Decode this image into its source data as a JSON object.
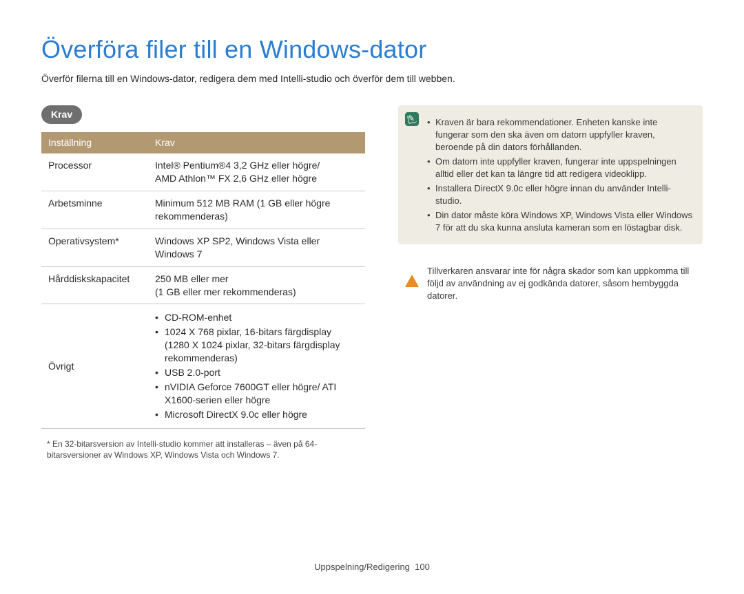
{
  "title": "Överföra filer till en Windows-dator",
  "subtitle": "Överför filerna till en Windows-dator, redigera dem med Intelli-studio och överför dem till webben.",
  "section": {
    "heading": "Krav",
    "table": {
      "head_setting": "Inställning",
      "head_req": "Krav",
      "rows_simple": [
        {
          "label": "Processor",
          "value": "Intel® Pentium®4 3,2 GHz eller högre/\nAMD Athlon™ FX 2,6 GHz eller högre"
        },
        {
          "label": "Arbetsminne",
          "value": "Minimum 512 MB RAM (1 GB eller högre rekommenderas)"
        },
        {
          "label": "Operativsystem*",
          "value": "Windows XP SP2, Windows Vista eller Windows 7"
        },
        {
          "label": "Hårddiskskapacitet",
          "value": "250 MB eller mer\n(1 GB eller mer rekommenderas)"
        }
      ],
      "row_other": {
        "label": "Övrigt",
        "items": [
          "CD-ROM-enhet",
          "1024 X 768 pixlar, 16-bitars färgdisplay (1280 X 1024 pixlar, 32-bitars färgdisplay rekommenderas)",
          "USB 2.0-port",
          "nVIDIA Geforce 7600GT eller högre/ ATI X1600-serien eller högre",
          "Microsoft DirectX 9.0c eller högre"
        ]
      }
    },
    "footnote": "* En 32-bitarsversion av Intelli-studio kommer att installeras – även på 64-bitarsversioner av Windows XP, Windows Vista och Windows 7."
  },
  "info_box": {
    "items": [
      "Kraven är bara rekommendationer. Enheten kanske inte fungerar som den ska även om datorn uppfyller kraven, beroende på din dators förhållanden.",
      "Om datorn inte uppfyller kraven, fungerar inte uppspelningen alltid eller det kan ta längre tid att redigera videoklipp.",
      "Installera DirectX 9.0c eller högre innan du använder Intelli-studio.",
      "Din dator måste köra Windows XP, Windows Vista eller Windows 7 för att du ska kunna ansluta kameran som en löstagbar disk."
    ]
  },
  "warn_box": {
    "text": "Tillverkaren ansvarar inte för några skador som kan uppkomma till följd av användning av ej godkända datorer, såsom hembyggda datorer."
  },
  "footer": {
    "section": "Uppspelning/Redigering",
    "page": "100"
  }
}
